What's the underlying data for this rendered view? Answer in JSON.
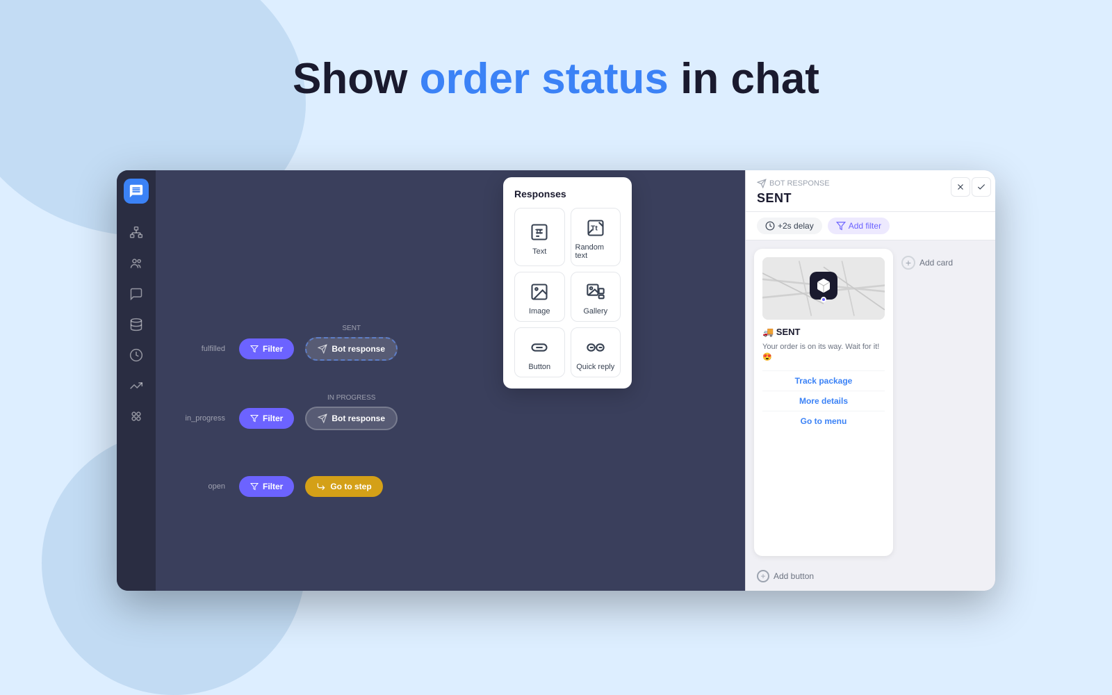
{
  "page": {
    "title_prefix": "Show ",
    "title_highlight": "order status",
    "title_suffix": " in chat",
    "bg_color": "#cce3f5"
  },
  "sidebar": {
    "items": [
      {
        "id": "chat",
        "icon": "chat-icon",
        "label": "Chat"
      },
      {
        "id": "org",
        "icon": "org-icon",
        "label": "Organization"
      },
      {
        "id": "contacts",
        "icon": "contacts-icon",
        "label": "Contacts"
      },
      {
        "id": "messages",
        "icon": "messages-icon",
        "label": "Messages"
      },
      {
        "id": "database",
        "icon": "database-icon",
        "label": "Database"
      },
      {
        "id": "analytics",
        "icon": "analytics-icon",
        "label": "Analytics"
      },
      {
        "id": "trends",
        "icon": "trends-icon",
        "label": "Trends"
      },
      {
        "id": "integrations",
        "icon": "integrations-icon",
        "label": "Integrations"
      }
    ]
  },
  "canvas": {
    "flow_rows": [
      {
        "label": "fulfilled",
        "filter_label": "Filter",
        "node_label": "SENT",
        "node_type": "bot_response",
        "node_icon": "bot-icon"
      },
      {
        "label": "in_progress",
        "filter_label": "Filter",
        "node_label": "IN PROGRESS",
        "node_type": "bot_response",
        "node_icon": "bot-icon"
      },
      {
        "label": "open",
        "filter_label": "Filter",
        "node_label": "Go to step",
        "node_type": "goto",
        "node_icon": "goto-icon"
      }
    ]
  },
  "responses_popup": {
    "title": "Responses",
    "items": [
      {
        "id": "text",
        "label": "Text",
        "icon": "text-icon"
      },
      {
        "id": "random-text",
        "label": "Random text",
        "icon": "random-text-icon"
      },
      {
        "id": "image",
        "label": "Image",
        "icon": "image-icon"
      },
      {
        "id": "gallery",
        "label": "Gallery",
        "icon": "gallery-icon"
      },
      {
        "id": "button",
        "label": "Button",
        "icon": "button-icon"
      },
      {
        "id": "quick-reply",
        "label": "Quick reply",
        "icon": "quick-reply-icon"
      }
    ]
  },
  "right_panel": {
    "bot_response_label": "BOT RESPONSE",
    "title": "SENT",
    "delay_btn": "+2s delay",
    "filter_btn": "Add filter",
    "card": {
      "sent_label": "🚚 SENT",
      "message": "Your order is on its way. Wait for it! 😍",
      "buttons": [
        {
          "label": "Track package"
        },
        {
          "label": "More details"
        },
        {
          "label": "Go to menu"
        }
      ]
    },
    "add_card_label": "Add card",
    "add_button_label": "Add button"
  }
}
